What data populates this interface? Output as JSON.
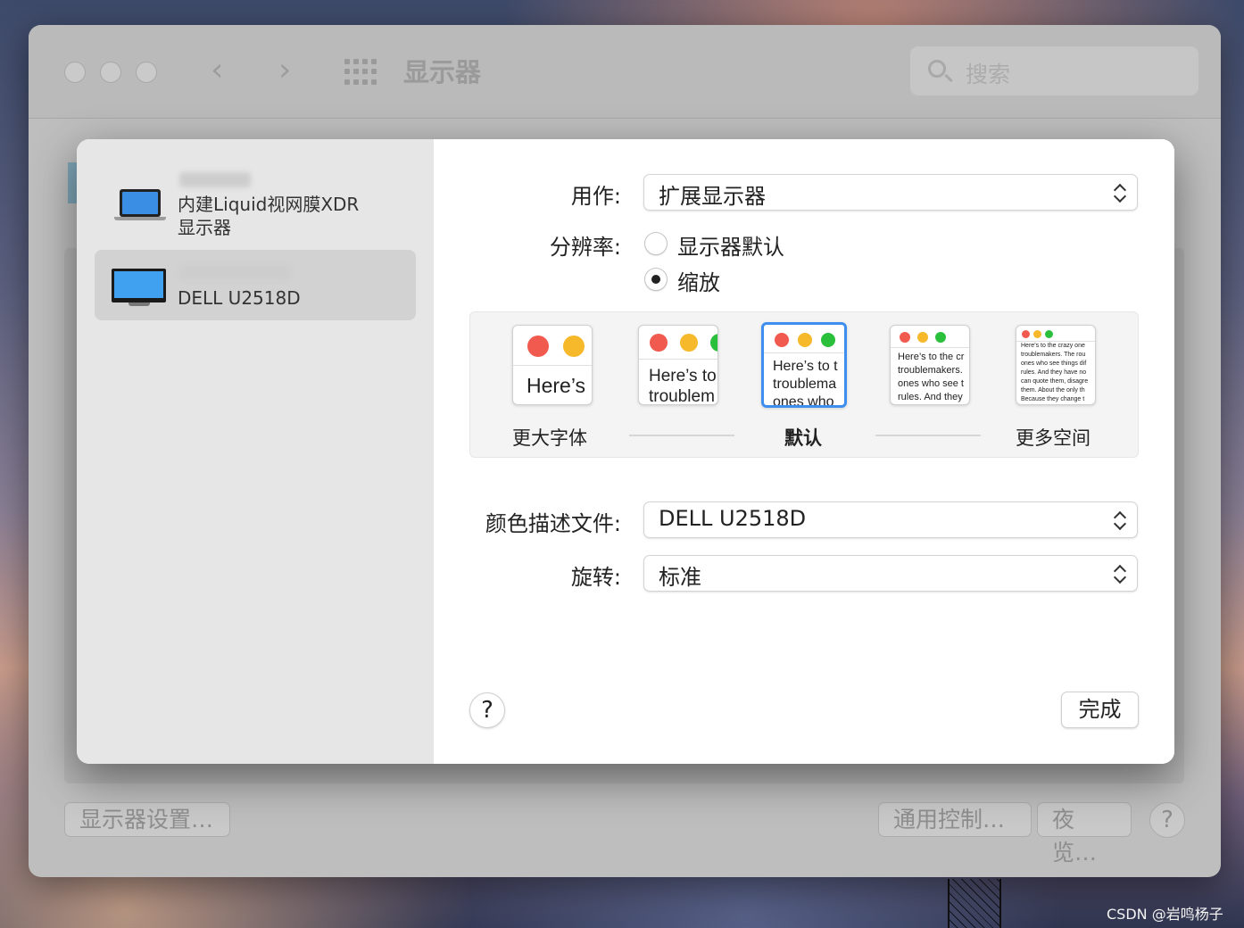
{
  "window": {
    "title": "显示器",
    "search_placeholder": "搜索"
  },
  "bottom_bar": {
    "display_settings": "显示器设置…",
    "universal_control": "通用控制…",
    "night_shift": "夜览…",
    "help": "?"
  },
  "sidebar": {
    "displays": [
      {
        "name": "内建Liquid视网膜XDR",
        "name2": "显示器",
        "selected": false
      },
      {
        "name": "DELL U2518D",
        "selected": true
      }
    ]
  },
  "settings": {
    "use_as_label": "用作:",
    "use_as_value": "扩展显示器",
    "resolution_label": "分辨率:",
    "resolution_options": [
      {
        "label": "显示器默认",
        "checked": false
      },
      {
        "label": "缩放",
        "checked": true
      }
    ],
    "scale_options": [
      {
        "caption": "更大字体",
        "preview": "Here’s"
      },
      {
        "caption": "",
        "preview1": "Here’s to",
        "preview2": "troublem"
      },
      {
        "caption": "默认",
        "preview1": "Here’s to t",
        "preview2": "troublema",
        "preview3": "ones who",
        "selected": true
      },
      {
        "caption": "",
        "preview1": "Here’s to the cr",
        "preview2": "troublemakers.",
        "preview3": "ones who see t",
        "preview4": "rules. And they"
      },
      {
        "caption": "更多空间",
        "lines": [
          "Here’s to the crazy one",
          "troublemakers. The rou",
          "ones who see things dif",
          "rules. And they have no",
          "can quote them, disagre",
          "them. About the only th",
          "Because they change t"
        ]
      }
    ],
    "color_profile_label": "颜色描述文件:",
    "color_profile_value": "DELL U2518D",
    "rotation_label": "旋转:",
    "rotation_value": "标准"
  },
  "sheet_buttons": {
    "help": "?",
    "done": "完成"
  },
  "watermark": "CSDN @岩鸣杨子",
  "colors": {
    "accent": "#3e8ef0",
    "traffic_red": "#f15a4f",
    "traffic_yellow": "#f6b92b",
    "traffic_green": "#2bc03c"
  }
}
